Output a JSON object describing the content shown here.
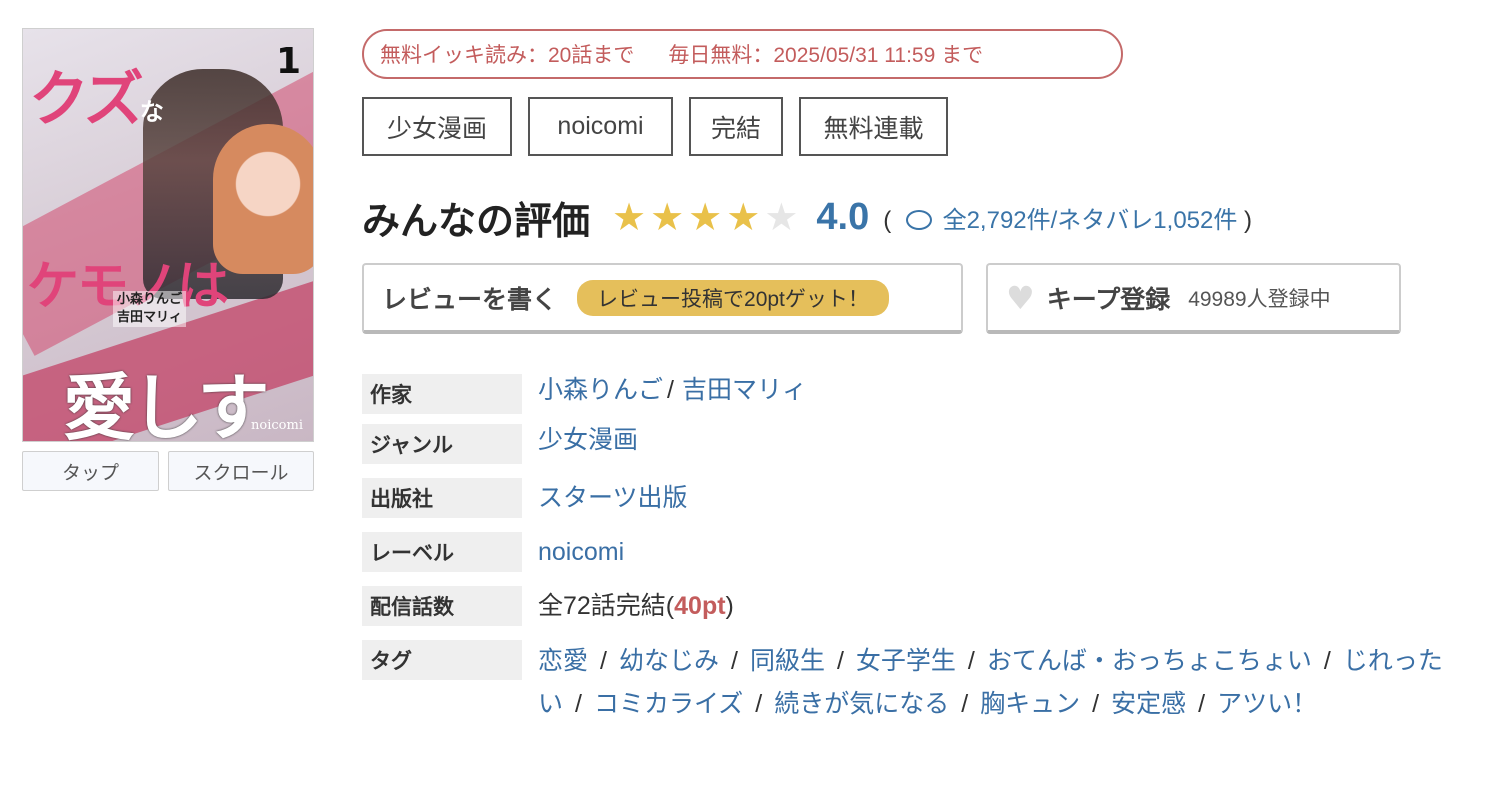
{
  "cover": {
    "title_line1": "クズ",
    "title_line1_small": "な",
    "title_line2": "ケモノは",
    "title_line3": "愛しすぎ",
    "volume": "1",
    "authors_line1": "小森りんご",
    "authors_line2": "吉田マリィ",
    "publisher_logo": "noicomi",
    "tap_label": "タップ",
    "scroll_label": "スクロール"
  },
  "free_info": {
    "free_read": "無料イッキ読み：20話まで",
    "daily_free": "毎日無料：2025/05/31 11:59 まで"
  },
  "tags": [
    "少女漫画",
    "noicomi",
    "完結",
    "無料連載"
  ],
  "rating": {
    "title": "みんなの評価",
    "stars": 4,
    "max_stars": 5,
    "score": "4.0",
    "open_paren": "(",
    "count_text": "全2,792件/ネタバレ1,052件",
    "close_paren": ")"
  },
  "review_button": {
    "label": "レビューを書く",
    "promo": "レビュー投稿で20ptゲット！"
  },
  "keep_button": {
    "label": "キープ登録",
    "count": "49989人登録中"
  },
  "details": {
    "author": {
      "label": "作家",
      "values": [
        "小森りんご",
        "吉田マリィ"
      ],
      "sep": "/"
    },
    "genre": {
      "label": "ジャンル",
      "value": "少女漫画"
    },
    "publisher": {
      "label": "出版社",
      "value": "スターツ出版"
    },
    "imprint": {
      "label": "レーベル",
      "value": "noicomi"
    },
    "episodes": {
      "label": "配信話数",
      "value_prefix": "全72話完結(",
      "points": "40pt",
      "value_suffix": ")"
    },
    "tag_list": {
      "label": "タグ",
      "items": [
        "恋愛",
        "幼なじみ",
        "同級生",
        "女子学生",
        "おてんば・おっちょこちょい",
        "じれったい",
        "コミカライズ",
        "続きが気になる",
        "胸キュン",
        "安定感",
        "アツい！"
      ]
    }
  }
}
